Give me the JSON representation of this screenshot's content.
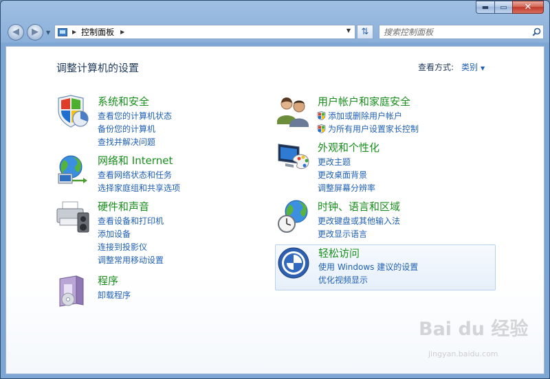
{
  "window": {
    "captions": {
      "minimize": "▬",
      "maximize": "▭",
      "close": "✕"
    }
  },
  "toolbar": {
    "back_glyph": "◀",
    "forward_glyph": "▶",
    "history_drop": "▼",
    "address": {
      "text": "控制面板",
      "arrow": "▶",
      "dropdown": "▼"
    },
    "refresh_glyph": "⇅",
    "search": {
      "placeholder": "搜索控制面板"
    }
  },
  "header": {
    "title": "调整计算机的设置",
    "view_by_label": "查看方式:",
    "view_by_value": "类别",
    "view_by_arrow": "▼"
  },
  "categories_left": [
    {
      "title": "系统和安全",
      "icon": "shield-pie-icon",
      "links": [
        "查看您的计算机状态",
        "备份您的计算机",
        "查找并解决问题"
      ]
    },
    {
      "title": "网络和 Internet",
      "icon": "network-globe-icon",
      "links": [
        "查看网络状态和任务",
        "选择家庭组和共享选项"
      ]
    },
    {
      "title": "硬件和声音",
      "icon": "printer-speaker-icon",
      "links": [
        "查看设备和打印机",
        "添加设备",
        "连接到投影仪",
        "调整常用移动设置"
      ]
    },
    {
      "title": "程序",
      "icon": "programs-box-icon",
      "links": [
        "卸载程序"
      ]
    }
  ],
  "categories_right": [
    {
      "title": "用户帐户和家庭安全",
      "icon": "users-icon",
      "links": [
        "添加或删除用户帐户",
        "为所有用户设置家长控制"
      ],
      "links_with_shield": true
    },
    {
      "title": "外观和个性化",
      "icon": "monitor-palette-icon",
      "links": [
        "更改主题",
        "更改桌面背景",
        "调整屏幕分辨率"
      ]
    },
    {
      "title": "时钟、语言和区域",
      "icon": "clock-globe-icon",
      "links": [
        "更改键盘或其他输入法",
        "更改显示语言"
      ]
    },
    {
      "title": "轻松访问",
      "icon": "ease-of-access-icon",
      "links": [
        "使用 Windows 建议的设置",
        "优化视频显示"
      ],
      "highlighted": true
    }
  ],
  "watermark": {
    "brand": "Bai du 经验",
    "url": "jingyan.baidu.com"
  },
  "colors": {
    "category_title": "#178e1b",
    "link": "#1e5fb4",
    "text": "#1e395b",
    "frame": "#8bb0da"
  }
}
